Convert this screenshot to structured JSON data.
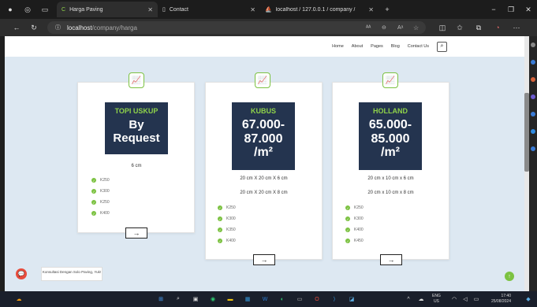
{
  "browser": {
    "tabs": [
      {
        "title": "Harga Paving",
        "active": true
      },
      {
        "title": "Contact",
        "active": false
      },
      {
        "title": "localhost / 127.0.0.1 / company /",
        "active": false
      }
    ],
    "url_host": "localhost",
    "url_path": "/company/harga"
  },
  "nav": {
    "items": [
      "Home",
      "About",
      "Pages",
      "Blog",
      "Contact Us"
    ]
  },
  "cards": [
    {
      "category": "TOPI USKUP",
      "price_lines": [
        "By",
        "Request"
      ],
      "sizes": [
        "6 cm"
      ],
      "grades": [
        "K250",
        "K300",
        "K250",
        "K400"
      ]
    },
    {
      "category": "KUBUS",
      "price_lines": [
        "67.000-",
        "87.000",
        "/m²"
      ],
      "sizes": [
        "20 cm X 20 cm X 6 cm",
        "20 cm X 20 cm X 8 cm"
      ],
      "grades": [
        "K250",
        "K300",
        "K350",
        "K400"
      ]
    },
    {
      "category": "HOLLAND",
      "price_lines": [
        "65.000-",
        "85.000",
        "/m²"
      ],
      "sizes": [
        "20 cm x 10 cm x 6 cm",
        "20 cm x 10 cm x 8 cm"
      ],
      "grades": [
        "K250",
        "K300",
        "K400",
        "K450"
      ]
    }
  ],
  "chat": {
    "label": "Konsultasi Dengan Solo Paving, Yuk!"
  },
  "taskbar": {
    "lang_top": "ENG",
    "lang_bottom": "US",
    "time": "17:40",
    "date": "25/08/2024"
  },
  "colors": {
    "accent": "#7cc242",
    "card_dark": "#24344f",
    "page_bg": "#dde8f2"
  }
}
